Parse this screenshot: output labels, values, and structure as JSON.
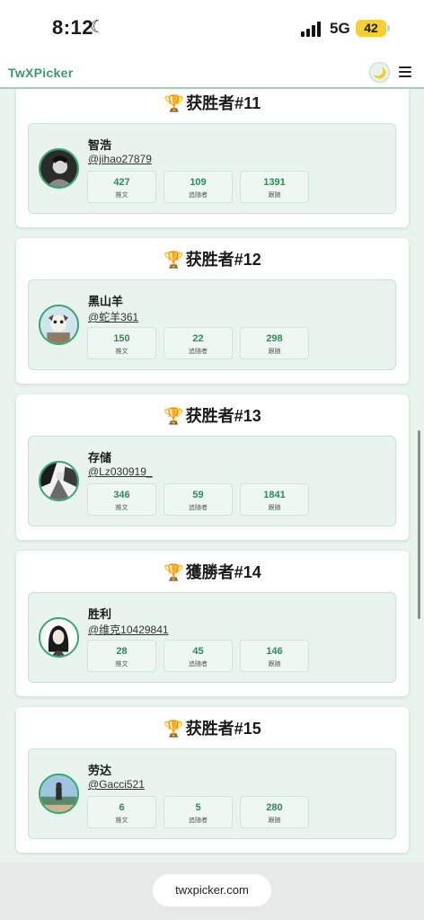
{
  "status": {
    "time": "8:12",
    "focus_icon": "crescent-moon-icon",
    "network": "5G",
    "battery": "42"
  },
  "header": {
    "brand": "TwXPicker",
    "theme_icon": "moon-icon",
    "menu_icon": "hamburger-icon"
  },
  "accent_colors": {
    "brand_green": "#3a9a68",
    "avatar_ring": "#3aa56e",
    "panel_bg": "#e8f4ed"
  },
  "winners": [
    {
      "title": "获胜者#11",
      "name": "智浩",
      "handle": "@jihao27879",
      "stats": [
        {
          "value": "427",
          "label": "推文"
        },
        {
          "value": "109",
          "label": "追随者"
        },
        {
          "value": "1391",
          "label": "跟随"
        }
      ]
    },
    {
      "title": "获胜者#12",
      "name": "黑山羊",
      "handle": "@蛇羊361",
      "stats": [
        {
          "value": "150",
          "label": "推文"
        },
        {
          "value": "22",
          "label": "追随者"
        },
        {
          "value": "298",
          "label": "跟随"
        }
      ]
    },
    {
      "title": "获胜者#13",
      "name": "存储",
      "handle": "@Lz030919_",
      "stats": [
        {
          "value": "346",
          "label": "推文"
        },
        {
          "value": "59",
          "label": "追随者"
        },
        {
          "value": "1841",
          "label": "跟随"
        }
      ]
    },
    {
      "title": "獲勝者#14",
      "name": "胜利",
      "handle": "@维克10429841",
      "stats": [
        {
          "value": "28",
          "label": "推文"
        },
        {
          "value": "45",
          "label": "追随者"
        },
        {
          "value": "146",
          "label": "跟随"
        }
      ]
    },
    {
      "title": "获胜者#15",
      "name": "劳达",
      "handle": "@Gacci521",
      "stats": [
        {
          "value": "6",
          "label": "推文"
        },
        {
          "value": "5",
          "label": "追随者"
        },
        {
          "value": "280",
          "label": "跟随"
        }
      ]
    }
  ],
  "browser": {
    "url": "twxpicker.com"
  }
}
